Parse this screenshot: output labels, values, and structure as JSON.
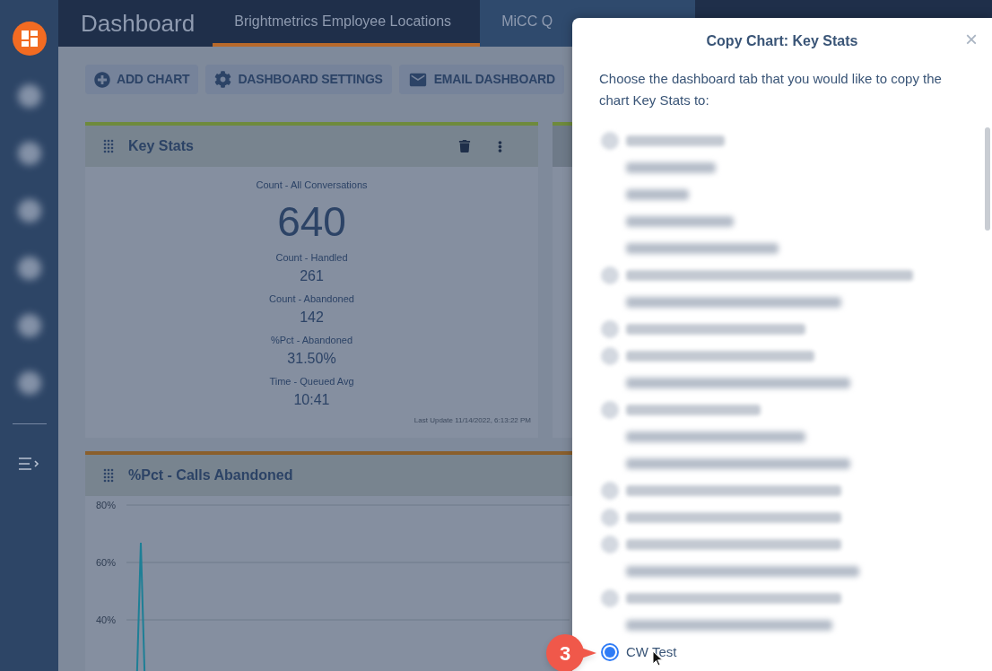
{
  "header": {
    "title": "Dashboard",
    "tabs": [
      {
        "label": "Brightmetrics Employee Locations",
        "selected": true
      },
      {
        "label": "MiCC Q",
        "selected": false
      }
    ]
  },
  "toolbar": {
    "buttons": [
      {
        "label": "ADD CHART",
        "kind": "add"
      },
      {
        "label": "DASHBOARD SETTINGS",
        "kind": "settings"
      },
      {
        "label": "EMAIL DASHBOARD",
        "kind": "email"
      }
    ]
  },
  "key_stats": {
    "title": "Key Stats",
    "headline": {
      "label": "Count - All Conversations",
      "value": "640"
    },
    "stats": [
      {
        "label": "Count - Handled",
        "value": "261"
      },
      {
        "label": "Count - Abandoned",
        "value": "142"
      },
      {
        "label": "%Pct - Abandoned",
        "value": "31.50%"
      },
      {
        "label": "Time - Queued Avg",
        "value": "10:41"
      }
    ],
    "footer": "Last Update 11/14/2022, 6:13:22 PM"
  },
  "abandoned_chart": {
    "title": "%Pct - Calls Abandoned",
    "axis_labels": [
      "80%",
      "60%",
      "40%"
    ]
  },
  "dialog": {
    "title": "Copy Chart: Key Stats",
    "close": "×",
    "text": "Choose the dashboard tab that you would like to copy the chart Key Stats to:",
    "options": [
      {
        "kind": "blurred_radio"
      },
      {
        "kind": "blurred_label"
      },
      {
        "kind": "blurred_label"
      },
      {
        "kind": "blurred_label"
      },
      {
        "kind": "blurred_label"
      },
      {
        "kind": "blurred_radio"
      },
      {
        "kind": "blurred_label"
      },
      {
        "kind": "blurred_radio"
      },
      {
        "kind": "blurred_radio"
      },
      {
        "kind": "blurred_label"
      },
      {
        "kind": "blurred_radio"
      },
      {
        "kind": "blurred_label"
      },
      {
        "kind": "blurred_label"
      },
      {
        "kind": "blurred_radio"
      },
      {
        "kind": "blurred_radio"
      },
      {
        "kind": "blurred_radio"
      },
      {
        "kind": "blurred_label"
      },
      {
        "kind": "blurred_radio"
      },
      {
        "kind": "blurred_label"
      },
      {
        "kind": "radio",
        "label": "CW Test",
        "selected": true
      }
    ]
  },
  "callout": {
    "label": "3"
  }
}
